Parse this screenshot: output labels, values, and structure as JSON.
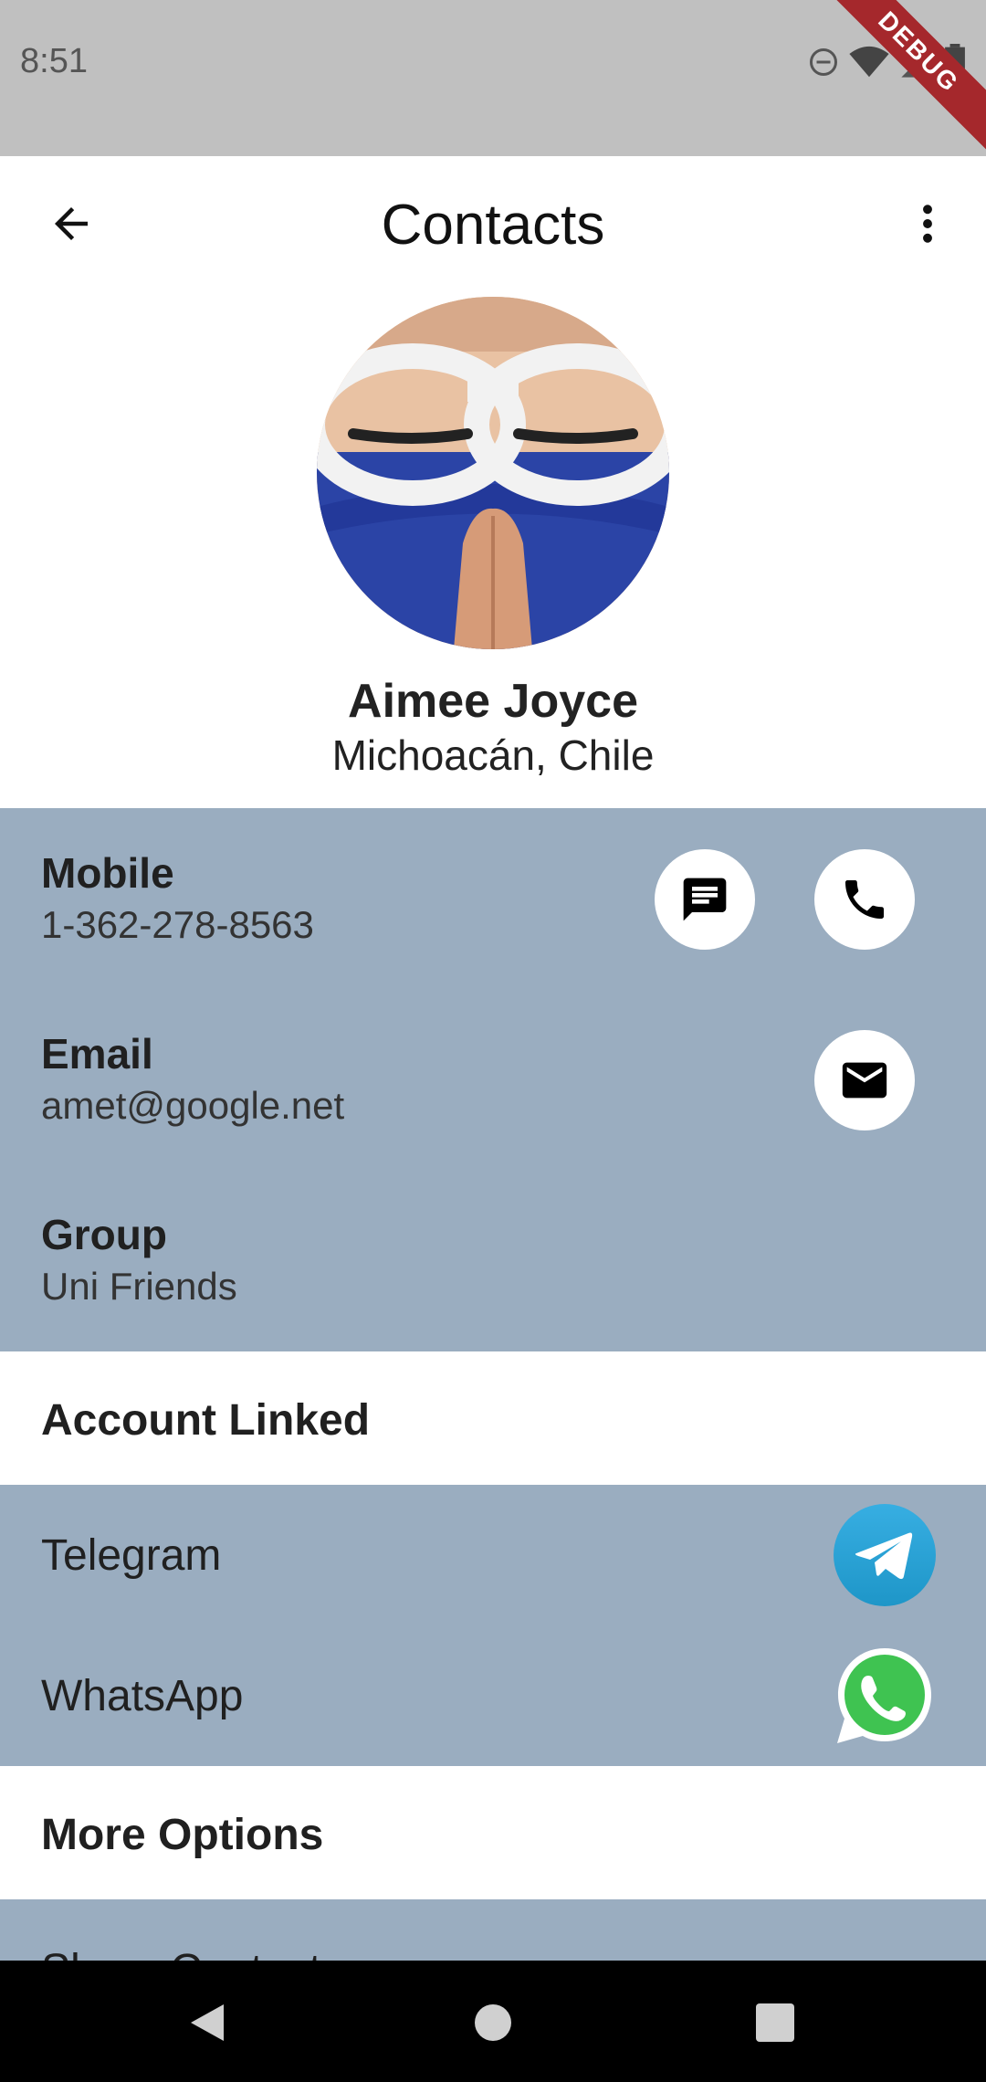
{
  "status_bar": {
    "time": "8:51",
    "debug_label": "DEBUG"
  },
  "app_bar": {
    "title": "Contacts"
  },
  "profile": {
    "name": "Aimee Joyce",
    "location": "Michoacán, Chile"
  },
  "contact_info": {
    "mobile": {
      "label": "Mobile",
      "value": "1-362-278-8563"
    },
    "email": {
      "label": "Email",
      "value": "amet@google.net"
    },
    "group": {
      "label": "Group",
      "value": "Uni Friends"
    }
  },
  "account_linked": {
    "header": "Account Linked",
    "items": [
      {
        "label": "Telegram"
      },
      {
        "label": "WhatsApp"
      }
    ]
  },
  "more_options": {
    "header": "More Options",
    "first_item": "Share Contact"
  },
  "colors": {
    "section_bg": "#9aadc0",
    "status_bar": "#c0c0c0",
    "telegram": "#2aa3e0",
    "whatsapp": "#3fc351"
  },
  "icons": [
    "back-arrow-icon",
    "more-vert-icon",
    "message-icon",
    "phone-icon",
    "email-icon",
    "telegram-icon",
    "whatsapp-icon"
  ]
}
